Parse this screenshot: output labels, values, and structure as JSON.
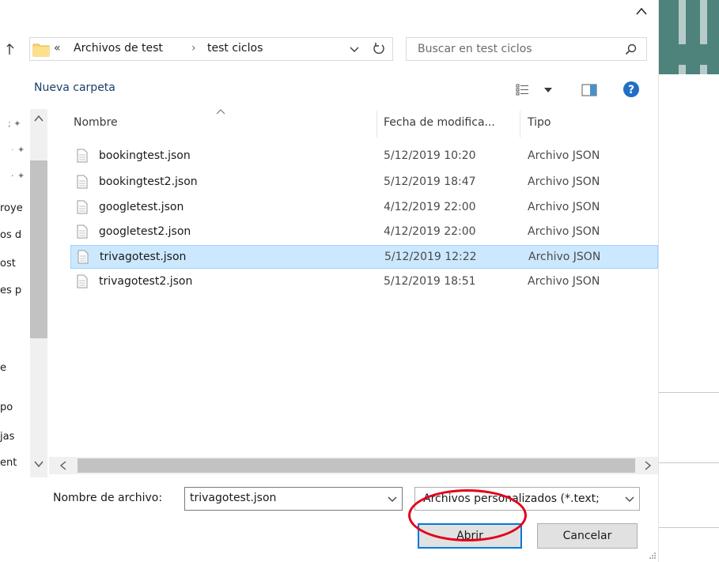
{
  "address_bar": {
    "overflow": "«",
    "crumbs": [
      "Archivos de test",
      "test ciclos"
    ],
    "separator": "›"
  },
  "search": {
    "placeholder": "Buscar en test ciclos"
  },
  "toolbar": {
    "new_folder_label": "Nueva carpeta"
  },
  "nav": {
    "items": [
      "",
      "",
      "",
      "roye",
      "os d",
      "ost",
      "es p",
      "e",
      "po",
      "jas",
      "ent"
    ]
  },
  "file_list": {
    "columns": [
      "Nombre",
      "Fecha de modifica...",
      "Tipo"
    ],
    "rows": [
      {
        "name": "bookingtest.json",
        "date": "5/12/2019 10:20",
        "type": "Archivo JSON",
        "selected": false
      },
      {
        "name": "bookingtest2.json",
        "date": "5/12/2019 18:47",
        "type": "Archivo JSON",
        "selected": false
      },
      {
        "name": "googletest.json",
        "date": "4/12/2019 22:00",
        "type": "Archivo JSON",
        "selected": false
      },
      {
        "name": "googletest2.json",
        "date": "4/12/2019 22:00",
        "type": "Archivo JSON",
        "selected": false
      },
      {
        "name": "trivagotest.json",
        "date": "5/12/2019 12:22",
        "type": "Archivo JSON",
        "selected": true
      },
      {
        "name": "trivagotest2.json",
        "date": "5/12/2019 18:51",
        "type": "Archivo JSON",
        "selected": false
      }
    ]
  },
  "footer": {
    "filename_label": "Nombre de archivo:",
    "filename_value": "trivagotest.json",
    "filter_value": "Archivos personalizados (*.text;",
    "open_label": "Abrir",
    "cancel_label": "Cancelar"
  },
  "colors": {
    "selection_bg": "#cce8ff",
    "selection_border": "#99d1ff",
    "primary_border": "#0078d7",
    "annotation_ring": "#e2001a"
  }
}
